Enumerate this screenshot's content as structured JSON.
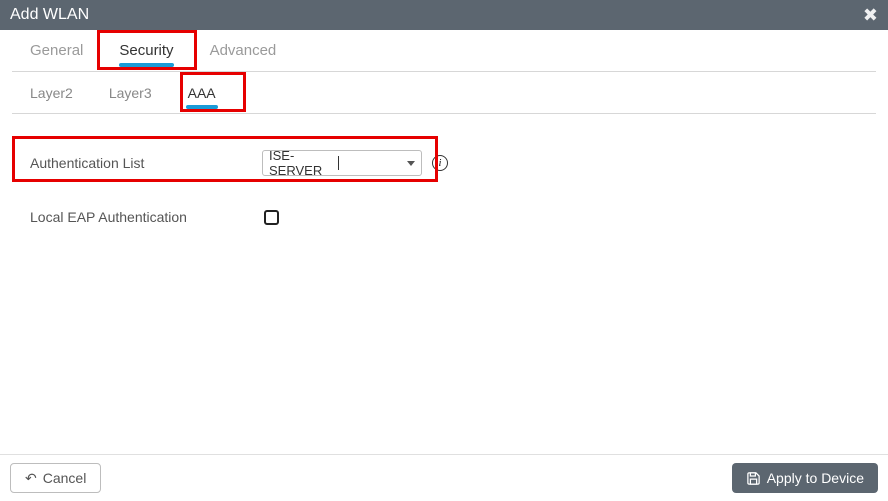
{
  "header": {
    "title": "Add WLAN"
  },
  "tabs_primary": {
    "general": "General",
    "security": "Security",
    "advanced": "Advanced",
    "active": "security"
  },
  "tabs_secondary": {
    "layer2": "Layer2",
    "layer3": "Layer3",
    "aaa": "AAA",
    "active": "aaa"
  },
  "form": {
    "auth_list_label": "Authentication List",
    "auth_list_value": "ISE-SERVER",
    "local_eap_label": "Local EAP Authentication",
    "local_eap_checked": false
  },
  "footer": {
    "cancel": "Cancel",
    "apply": "Apply to Device"
  },
  "colors": {
    "highlight": "#e60000",
    "tab_underline": "#1a9bd7",
    "header_bg": "#5c6670"
  }
}
